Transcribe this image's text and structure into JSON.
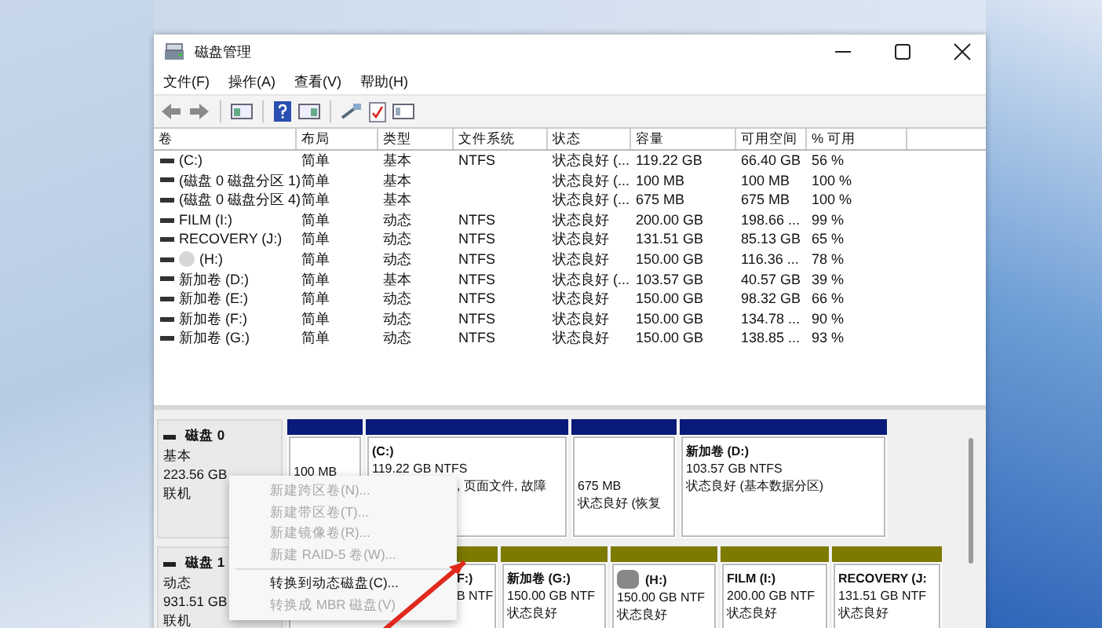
{
  "window": {
    "title": "磁盘管理"
  },
  "menu": [
    "文件(F)",
    "操作(A)",
    "查看(V)",
    "帮助(H)"
  ],
  "table": {
    "columns": [
      "卷",
      "布局",
      "类型",
      "文件系统",
      "状态",
      "容量",
      "可用空间",
      "% 可用"
    ],
    "rows": [
      {
        "cells": [
          "(C:)",
          "简单",
          "基本",
          "NTFS",
          "状态良好 (...",
          "119.22 GB",
          "66.40 GB",
          "56 %"
        ],
        "blurred": false
      },
      {
        "cells": [
          "(磁盘 0 磁盘分区 1)",
          "简单",
          "基本",
          "",
          "状态良好 (...",
          "100 MB",
          "100 MB",
          "100 %"
        ],
        "blurred": false
      },
      {
        "cells": [
          "(磁盘 0 磁盘分区 4)",
          "简单",
          "基本",
          "",
          "状态良好 (...",
          "675 MB",
          "675 MB",
          "100 %"
        ],
        "blurred": false
      },
      {
        "cells": [
          "FILM (I:)",
          "简单",
          "动态",
          "NTFS",
          "状态良好",
          "200.00 GB",
          "198.66 ...",
          "99 %"
        ],
        "blurred": false
      },
      {
        "cells": [
          "RECOVERY (J:)",
          "简单",
          "动态",
          "NTFS",
          "状态良好",
          "131.51 GB",
          "85.13 GB",
          "65 %"
        ],
        "blurred": false
      },
      {
        "cells": [
          "(H:)",
          "简单",
          "动态",
          "NTFS",
          "状态良好",
          "150.00 GB",
          "116.36 ...",
          "78 %"
        ],
        "blurred": true
      },
      {
        "cells": [
          "新加卷 (D:)",
          "简单",
          "基本",
          "NTFS",
          "状态良好 (...",
          "103.57 GB",
          "40.57 GB",
          "39 %"
        ],
        "blurred": false
      },
      {
        "cells": [
          "新加卷 (E:)",
          "简单",
          "动态",
          "NTFS",
          "状态良好",
          "150.00 GB",
          "98.32 GB",
          "66 %"
        ],
        "blurred": false
      },
      {
        "cells": [
          "新加卷 (F:)",
          "简单",
          "动态",
          "NTFS",
          "状态良好",
          "150.00 GB",
          "134.78 ...",
          "90 %"
        ],
        "blurred": false
      },
      {
        "cells": [
          "新加卷 (G:)",
          "简单",
          "动态",
          "NTFS",
          "状态良好",
          "150.00 GB",
          "138.85 ...",
          "93 %"
        ],
        "blurred": false
      }
    ]
  },
  "disks": [
    {
      "name": "磁盘 0",
      "kind": "basic",
      "type": "基本",
      "size": "223.56 GB",
      "status": "联机",
      "partitions": [
        {
          "detail": "100 MB",
          "blurred": false
        },
        {
          "name": "(C:)",
          "detail": "119.22 GB NTFS",
          "status": ", 页面文件, 故障",
          "blurred": false
        },
        {
          "detail": "675 MB",
          "status": "状态良好 (恢复",
          "blurred": false
        },
        {
          "name": "新加卷  (D:)",
          "detail": "103.57 GB NTFS",
          "status": "状态良好 (基本数据分区)",
          "blurred": false
        }
      ]
    },
    {
      "name": "磁盘 1",
      "kind": "dynamic",
      "type": "动态",
      "size": "931.51 GB",
      "status": "联机",
      "partitions": [
        {
          "name": "F:)",
          "detail": "B NTF",
          "blurred": false
        },
        {
          "name": "新加卷  (G:)",
          "detail": "150.00 GB NTF",
          "status": "状态良好",
          "blurred": false
        },
        {
          "name": "(H:)",
          "detail": "150.00 GB NTF",
          "status": "状态良好",
          "blurred": true
        },
        {
          "name": "FILM  (I:)",
          "detail": "200.00 GB NTF",
          "status": "状态良好",
          "blurred": false
        },
        {
          "name": "RECOVERY  (J:",
          "detail": "131.51 GB NTF",
          "status": "状态良好",
          "blurred": false
        }
      ]
    }
  ],
  "context_menu": [
    {
      "kind": "item",
      "label": "新建跨区卷(N)...",
      "disabled": true
    },
    {
      "kind": "item",
      "label": "新建带区卷(T)...",
      "disabled": true
    },
    {
      "kind": "item",
      "label": "新建镜像卷(R)...",
      "disabled": true
    },
    {
      "kind": "item",
      "label": "新建 RAID-5 卷(W)...",
      "disabled": true
    },
    {
      "kind": "separator"
    },
    {
      "kind": "item",
      "label": "转换到动态磁盘(C)...",
      "disabled": false
    },
    {
      "kind": "item",
      "label": "转换成 MBR 磁盘(V)",
      "disabled": true
    }
  ]
}
